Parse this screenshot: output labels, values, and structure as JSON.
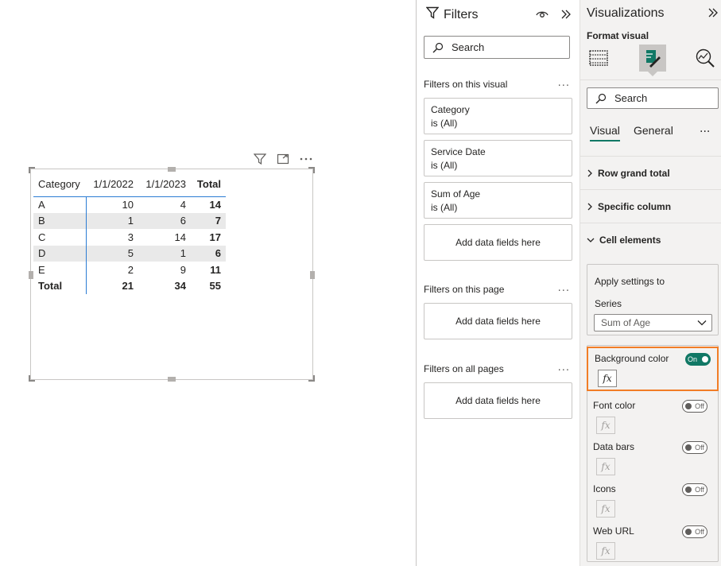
{
  "matrix": {
    "headers": [
      "Category",
      "1/1/2022",
      "1/1/2023",
      "Total"
    ],
    "rows": [
      {
        "cat": "A",
        "v1": "10",
        "v2": "4",
        "total": "14"
      },
      {
        "cat": "B",
        "v1": "1",
        "v2": "6",
        "total": "7"
      },
      {
        "cat": "C",
        "v1": "3",
        "v2": "14",
        "total": "17"
      },
      {
        "cat": "D",
        "v1": "5",
        "v2": "1",
        "total": "6"
      },
      {
        "cat": "E",
        "v1": "2",
        "v2": "9",
        "total": "11"
      }
    ],
    "total_row": {
      "cat": "Total",
      "v1": "21",
      "v2": "34",
      "total": "55"
    }
  },
  "filters": {
    "title": "Filters",
    "search_placeholder": "Search",
    "on_visual_label": "Filters on this visual",
    "visual_cards": [
      {
        "field": "Category",
        "state": "is (All)"
      },
      {
        "field": "Service Date",
        "state": "is (All)"
      },
      {
        "field": "Sum of Age",
        "state": "is (All)"
      }
    ],
    "add_fields": "Add data fields here",
    "on_page_label": "Filters on this page",
    "on_all_pages_label": "Filters on all pages",
    "more": "..."
  },
  "viz": {
    "title": "Visualizations",
    "format_label": "Format visual",
    "search_placeholder": "Search",
    "tabs": [
      "Visual",
      "General"
    ],
    "more": "...",
    "sections": [
      "Row grand total",
      "Specific column",
      "Cell elements"
    ],
    "apply_label": "Apply settings to",
    "series_label": "Series",
    "series_value": "Sum of Age",
    "options": [
      {
        "name": "Background color",
        "state": "On"
      },
      {
        "name": "Font color",
        "state": "Off"
      },
      {
        "name": "Data bars",
        "state": "Off"
      },
      {
        "name": "Icons",
        "state": "Off"
      },
      {
        "name": "Web URL",
        "state": "Off"
      }
    ],
    "fx": "fx",
    "accent": "#117865",
    "highlight": "#f17d26"
  }
}
